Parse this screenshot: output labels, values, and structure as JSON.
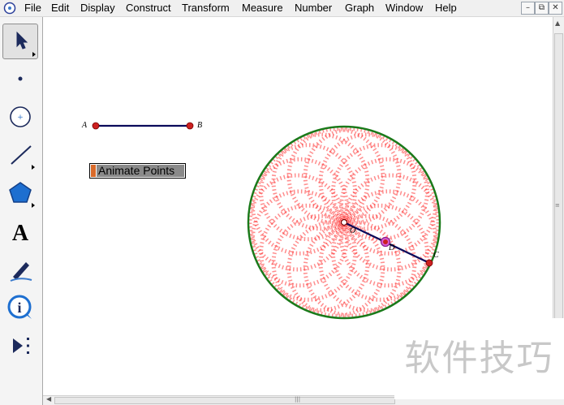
{
  "menubar": {
    "items": [
      "File",
      "Edit",
      "Display",
      "Construct",
      "Transform",
      "Measure",
      "Number",
      "Graph",
      "Window",
      "Help"
    ],
    "minimize": "–",
    "restore": "⧉",
    "close": "✕"
  },
  "toolbox": {
    "tools": [
      "arrow-select-tool",
      "point-tool",
      "compass-tool",
      "straightedge-tool",
      "polygon-tool",
      "text-tool",
      "marker-tool",
      "information-tool",
      "custom-tool"
    ],
    "text_tool_glyph": "A",
    "info_glyph": "i"
  },
  "sketch": {
    "point_a_label": "A",
    "point_b_label": "B",
    "point_c_label": "C",
    "point_o_label": "O",
    "point_d_label": "D",
    "animate_button_label": "Animate Points",
    "colors": {
      "segment": "#0a0a5a",
      "circle": "#1a7a1a",
      "trace": "#ff3030",
      "point": "#cc2020"
    }
  },
  "watermark": "软件技巧"
}
